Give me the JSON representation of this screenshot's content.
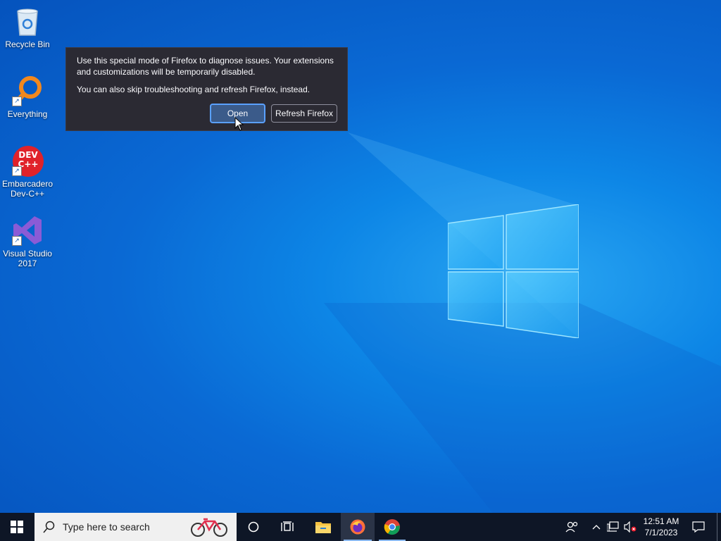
{
  "desktop": {
    "icons": [
      {
        "label": "Recycle Bin"
      },
      {
        "label": "Everything"
      },
      {
        "label": "Embarcadero Dev-C++"
      },
      {
        "label": "Visual Studio 2017"
      }
    ],
    "devcpp_logo_text": "DEV C++"
  },
  "dialog": {
    "message": "Use this special mode of Firefox to diagnose issues. Your extensions and customizations will be temporarily disabled.",
    "secondary": "You can also skip troubleshooting and refresh Firefox, instead.",
    "open_label": "Open",
    "refresh_label": "Refresh Firefox"
  },
  "taskbar": {
    "search_placeholder": "Type here to search",
    "apps": [
      "cortana-icon",
      "task-view-icon",
      "file-explorer-icon",
      "firefox-icon",
      "chrome-icon"
    ],
    "active_app": "firefox",
    "clock_time": "12:51 AM",
    "clock_date": "7/1/2023"
  },
  "colors": {
    "dialog_bg": "#2b2a33",
    "primary_border": "#5aa0ff",
    "taskbar_bg": "#0e1626"
  }
}
